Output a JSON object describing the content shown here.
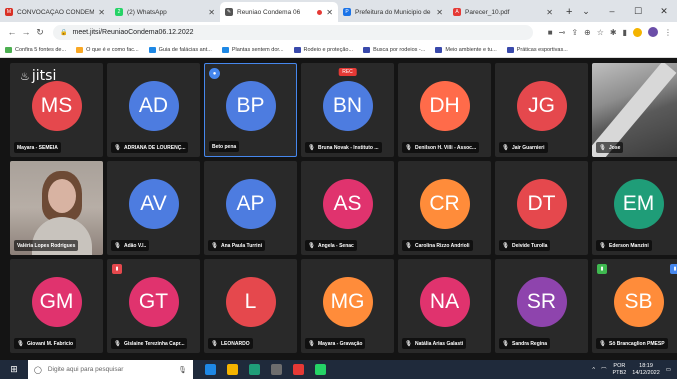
{
  "browser": {
    "tabs": [
      {
        "title": "CONVOCAÇÃO CONDEMA",
        "favicon_color": "#d93025",
        "favicon_glyph": "M",
        "active": false,
        "width": 110
      },
      {
        "title": "(2) WhatsApp",
        "favicon_color": "#25d366",
        "favicon_glyph": "2",
        "active": false,
        "width": 110
      },
      {
        "title": "Reuniao Condema 06",
        "favicon_color": "#555555",
        "favicon_glyph": "✎",
        "active": true,
        "recording": true,
        "width": 118
      },
      {
        "title": "Prefeitura do Municipio de",
        "favicon_color": "#1a73e8",
        "favicon_glyph": "P",
        "active": false,
        "width": 110
      },
      {
        "title": "Parecer_10.pdf",
        "favicon_color": "#e53935",
        "favicon_glyph": "A",
        "active": false,
        "width": 110
      }
    ],
    "url": "meet.jitsi/ReuniaoCondema06.12.2022",
    "bookmarks": [
      {
        "label": "Confira 5 fontes de...",
        "color": "#4caf50"
      },
      {
        "label": "O que é e como fac...",
        "color": "#f9a825"
      },
      {
        "label": "Guia de falácias ant...",
        "color": "#1e88e5"
      },
      {
        "label": "Plantas sentem dor...",
        "color": "#1e88e5"
      },
      {
        "label": "Rodeio e proteção...",
        "color": "#3949ab"
      },
      {
        "label": "Busca por rodeios -...",
        "color": "#3949ab"
      },
      {
        "label": "Meio ambiente e tu...",
        "color": "#3949ab"
      },
      {
        "label": "Práticas esportivas...",
        "color": "#3949ab"
      }
    ]
  },
  "jitsi": {
    "logo": "jitsi",
    "rec_label": "REC",
    "participants": [
      {
        "initials": "MS",
        "name": "Mayara - SEMEIA",
        "color": "#e5484d",
        "mic": false,
        "row": 0,
        "col": 0
      },
      {
        "initials": "AD",
        "name": "ADRIANA DE LOURENÇ...",
        "color": "#4d7ce0",
        "mic": true,
        "row": 0,
        "col": 1
      },
      {
        "initials": "BP",
        "name": "Beto pena",
        "color": "#4d7ce0",
        "mic": false,
        "row": 0,
        "col": 2,
        "active": true,
        "dominant": true
      },
      {
        "initials": "BN",
        "name": "Bruna Novak - Instituto ...",
        "color": "#4d7ce0",
        "mic": true,
        "row": 0,
        "col": 3,
        "rec": true
      },
      {
        "initials": "DH",
        "name": "Denilson H. Villi - Assoc...",
        "color": "#ff6b4a",
        "mic": true,
        "row": 0,
        "col": 4
      },
      {
        "initials": "JG",
        "name": "Jair Guarnieri",
        "color": "#e5484d",
        "mic": true,
        "row": 0,
        "col": 5
      },
      {
        "initials": "",
        "name": "Jose",
        "color": "#292929",
        "mic": true,
        "row": 0,
        "col": 6,
        "video": "jose"
      },
      {
        "initials": "",
        "name": "Valéria Lopes Rodrigues",
        "color": "#292929",
        "mic": false,
        "row": 1,
        "col": 0,
        "video": "valeria"
      },
      {
        "initials": "AV",
        "name": "Adão V.l..",
        "color": "#4d7ce0",
        "mic": true,
        "row": 1,
        "col": 1
      },
      {
        "initials": "AP",
        "name": "Ana Paula Turrini",
        "color": "#4d7ce0",
        "mic": true,
        "row": 1,
        "col": 2
      },
      {
        "initials": "AS",
        "name": "Angela - Senac",
        "color": "#e0336e",
        "mic": true,
        "row": 1,
        "col": 3
      },
      {
        "initials": "CR",
        "name": "Carolina Rizzo Andrioli",
        "color": "#ff8c3a",
        "mic": true,
        "row": 1,
        "col": 4
      },
      {
        "initials": "DT",
        "name": "Deivide Turolla",
        "color": "#e5484d",
        "mic": true,
        "row": 1,
        "col": 5
      },
      {
        "initials": "EM",
        "name": "Ederson Manzini",
        "color": "#1f9d78",
        "mic": true,
        "row": 1,
        "col": 6
      },
      {
        "initials": "GM",
        "name": "Giovani M. Fabricio",
        "color": "#e0336e",
        "mic": true,
        "row": 2,
        "col": 0
      },
      {
        "initials": "GT",
        "name": "Gislaine Terezinha Capr...",
        "color": "#e0336e",
        "mic": true,
        "row": 2,
        "col": 1,
        "corner_badge": {
          "side": "left",
          "color": "#e5484d"
        }
      },
      {
        "initials": "L",
        "name": "LEONARDO",
        "color": "#e5484d",
        "mic": true,
        "row": 2,
        "col": 2
      },
      {
        "initials": "MG",
        "name": "Mayara - Gravação",
        "color": "#ff8c3a",
        "mic": true,
        "row": 2,
        "col": 3
      },
      {
        "initials": "NA",
        "name": "Natália Arias Galasti",
        "color": "#e0336e",
        "mic": true,
        "row": 2,
        "col": 4
      },
      {
        "initials": "SR",
        "name": "Sandra Regina",
        "color": "#8e44ad",
        "mic": true,
        "row": 2,
        "col": 5
      },
      {
        "initials": "SB",
        "name": "Sô Brancaglion PMESP",
        "color": "#ff8c3a",
        "mic": true,
        "row": 2,
        "col": 6,
        "corner_badge": {
          "side": "left",
          "color": "#3fb950"
        },
        "corner_badge2": {
          "side": "right",
          "color": "#4687ed"
        }
      }
    ]
  },
  "taskbar": {
    "search_placeholder": "Digite aqui para pesquisar",
    "lang": "POR",
    "lang2": "PTB2",
    "time": "18:19",
    "date": "14/12/2022",
    "icons": [
      "#1e88e5",
      "#f4b400",
      "#1f9d78",
      "#6d6d6d",
      "#e53935",
      "#25d366"
    ]
  }
}
